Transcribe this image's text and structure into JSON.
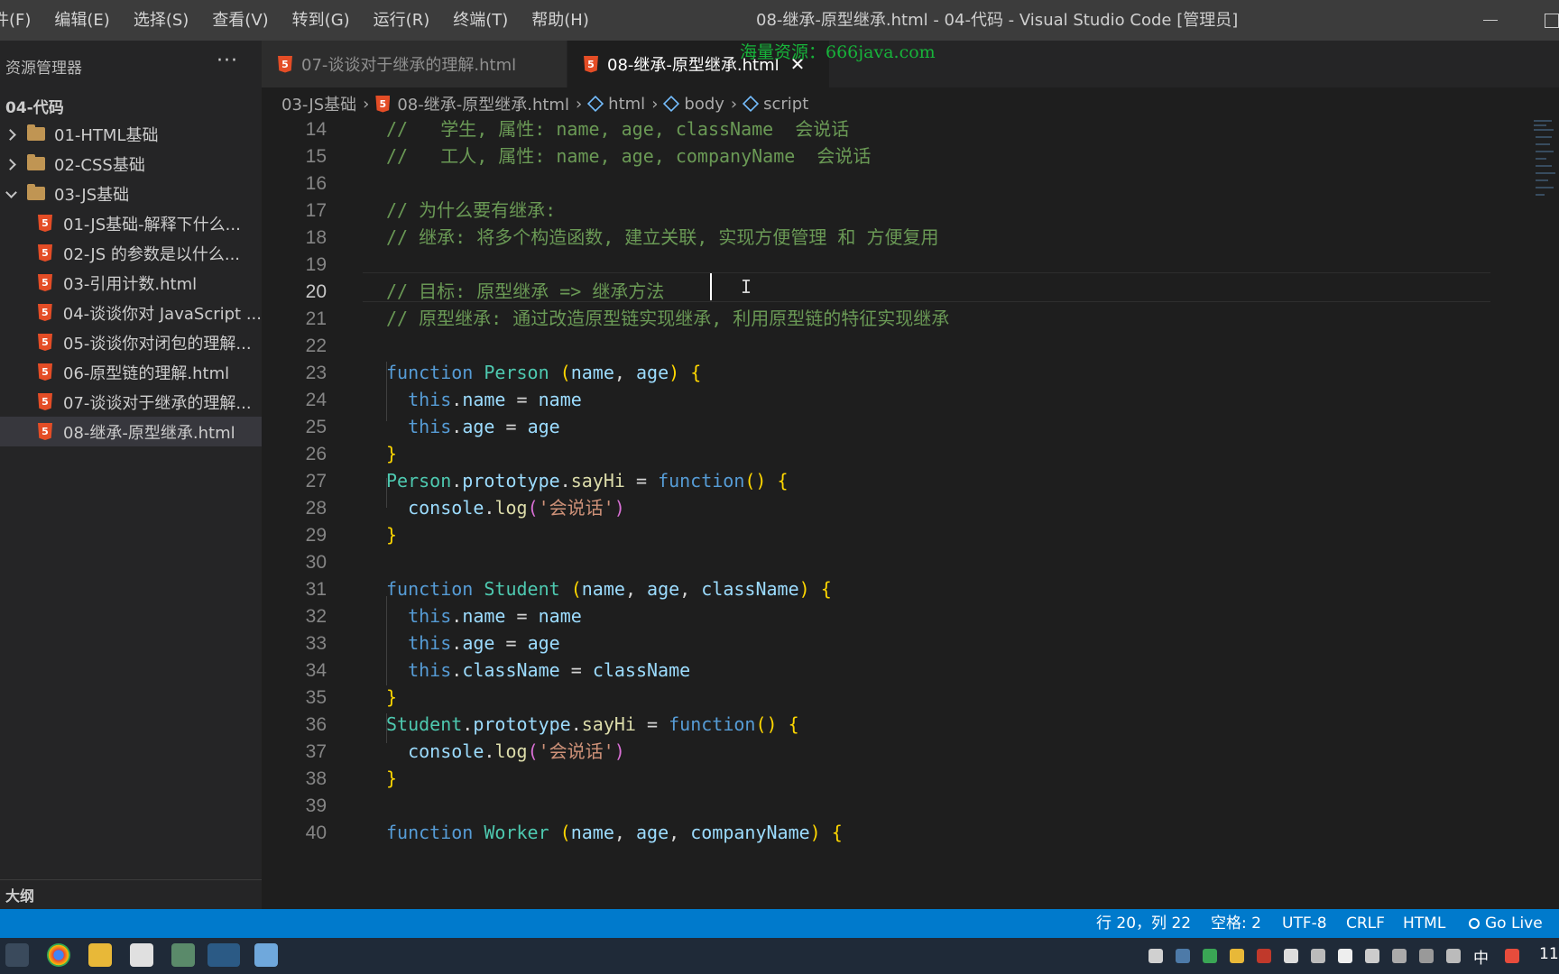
{
  "menu": [
    "件(F)",
    "编辑(E)",
    "选择(S)",
    "查看(V)",
    "转到(G)",
    "运行(R)",
    "终端(T)",
    "帮助(H)"
  ],
  "window_title": "08-继承-原型继承.html - 04-代码 - Visual Studio Code [管理员]",
  "watermark": "海量资源：666java.com",
  "sidebar": {
    "title": "资源管理器",
    "more": "···",
    "root": "04-代码",
    "folders": [
      "01-HTML基础",
      "02-CSS基础",
      "03-JS基础"
    ],
    "files": [
      "01-JS基础-解释下什么...",
      "02-JS 的参数是以什么...",
      "03-引用计数.html",
      "04-谈谈你对 JavaScript ...",
      "05-谈谈你对闭包的理解...",
      "06-原型链的理解.html",
      "07-谈谈对于继承的理解...",
      "08-继承-原型继承.html"
    ],
    "outline": "大纲"
  },
  "tabs": [
    {
      "label": "07-谈谈对于继承的理解.html",
      "icon": "html5-icon"
    },
    {
      "label": "08-继承-原型继承.html",
      "icon": "html5-icon",
      "close": "✕"
    }
  ],
  "breadcrumb": [
    "03-JS基础",
    "08-继承-原型继承.html",
    "html",
    "body",
    "script"
  ],
  "code_lines": [
    {
      "n": "14",
      "code": [
        [
          "c-com",
          "//   学生, 属性: name, age, className  会说话"
        ]
      ]
    },
    {
      "n": "15",
      "code": [
        [
          "c-com",
          "//   工人, 属性: name, age, companyName  会说话"
        ]
      ]
    },
    {
      "n": "16",
      "code": []
    },
    {
      "n": "17",
      "code": [
        [
          "c-com",
          "// 为什么要有继承:"
        ]
      ]
    },
    {
      "n": "18",
      "code": [
        [
          "c-com",
          "// 继承: 将多个构造函数, 建立关联, 实现方便管理 和 方便复用"
        ]
      ]
    },
    {
      "n": "19",
      "code": []
    },
    {
      "n": "20",
      "code": [
        [
          "c-com",
          "// 目标: 原型继承 => 继承方法"
        ]
      ]
    },
    {
      "n": "21",
      "code": [
        [
          "c-com",
          "// 原型继承: 通过改造原型链实现继承, 利用原型链的特征实现继承"
        ]
      ]
    },
    {
      "n": "22",
      "code": []
    },
    {
      "n": "23",
      "code": [
        [
          "c-kw",
          "function "
        ],
        [
          "c-cls",
          "Person"
        ],
        [
          "c-op",
          " "
        ],
        [
          "c-br1",
          "("
        ],
        [
          "c-var",
          "name"
        ],
        [
          "c-op",
          ", "
        ],
        [
          "c-var",
          "age"
        ],
        [
          "c-br1",
          ")"
        ],
        [
          "c-op",
          " "
        ],
        [
          "c-br1",
          "{"
        ]
      ]
    },
    {
      "n": "24",
      "code": [
        [
          "c-op",
          "  "
        ],
        [
          "c-kw",
          "this"
        ],
        [
          "c-op",
          "."
        ],
        [
          "c-var",
          "name"
        ],
        [
          "c-op",
          " = "
        ],
        [
          "c-var",
          "name"
        ]
      ]
    },
    {
      "n": "25",
      "code": [
        [
          "c-op",
          "  "
        ],
        [
          "c-kw",
          "this"
        ],
        [
          "c-op",
          "."
        ],
        [
          "c-var",
          "age"
        ],
        [
          "c-op",
          " = "
        ],
        [
          "c-var",
          "age"
        ]
      ]
    },
    {
      "n": "26",
      "code": [
        [
          "c-br1",
          "}"
        ]
      ]
    },
    {
      "n": "27",
      "code": [
        [
          "c-cls",
          "Person"
        ],
        [
          "c-op",
          "."
        ],
        [
          "c-var",
          "prototype"
        ],
        [
          "c-op",
          "."
        ],
        [
          "c-fn",
          "sayHi"
        ],
        [
          "c-op",
          " = "
        ],
        [
          "c-kw",
          "function"
        ],
        [
          "c-br1",
          "()"
        ],
        [
          "c-op",
          " "
        ],
        [
          "c-br1",
          "{"
        ]
      ]
    },
    {
      "n": "28",
      "code": [
        [
          "c-op",
          "  "
        ],
        [
          "c-var",
          "console"
        ],
        [
          "c-op",
          "."
        ],
        [
          "c-fn",
          "log"
        ],
        [
          "c-br2",
          "("
        ],
        [
          "c-str",
          "'会说话'"
        ],
        [
          "c-br2",
          ")"
        ]
      ]
    },
    {
      "n": "29",
      "code": [
        [
          "c-br1",
          "}"
        ]
      ]
    },
    {
      "n": "30",
      "code": []
    },
    {
      "n": "31",
      "code": [
        [
          "c-kw",
          "function "
        ],
        [
          "c-cls",
          "Student"
        ],
        [
          "c-op",
          " "
        ],
        [
          "c-br1",
          "("
        ],
        [
          "c-var",
          "name"
        ],
        [
          "c-op",
          ", "
        ],
        [
          "c-var",
          "age"
        ],
        [
          "c-op",
          ", "
        ],
        [
          "c-var",
          "className"
        ],
        [
          "c-br1",
          ")"
        ],
        [
          "c-op",
          " "
        ],
        [
          "c-br1",
          "{"
        ]
      ]
    },
    {
      "n": "32",
      "code": [
        [
          "c-op",
          "  "
        ],
        [
          "c-kw",
          "this"
        ],
        [
          "c-op",
          "."
        ],
        [
          "c-var",
          "name"
        ],
        [
          "c-op",
          " = "
        ],
        [
          "c-var",
          "name"
        ]
      ]
    },
    {
      "n": "33",
      "code": [
        [
          "c-op",
          "  "
        ],
        [
          "c-kw",
          "this"
        ],
        [
          "c-op",
          "."
        ],
        [
          "c-var",
          "age"
        ],
        [
          "c-op",
          " = "
        ],
        [
          "c-var",
          "age"
        ]
      ]
    },
    {
      "n": "34",
      "code": [
        [
          "c-op",
          "  "
        ],
        [
          "c-kw",
          "this"
        ],
        [
          "c-op",
          "."
        ],
        [
          "c-var",
          "className"
        ],
        [
          "c-op",
          " = "
        ],
        [
          "c-var",
          "className"
        ]
      ]
    },
    {
      "n": "35",
      "code": [
        [
          "c-br1",
          "}"
        ]
      ]
    },
    {
      "n": "36",
      "code": [
        [
          "c-cls",
          "Student"
        ],
        [
          "c-op",
          "."
        ],
        [
          "c-var",
          "prototype"
        ],
        [
          "c-op",
          "."
        ],
        [
          "c-fn",
          "sayHi"
        ],
        [
          "c-op",
          " = "
        ],
        [
          "c-kw",
          "function"
        ],
        [
          "c-br1",
          "()"
        ],
        [
          "c-op",
          " "
        ],
        [
          "c-br1",
          "{"
        ]
      ]
    },
    {
      "n": "37",
      "code": [
        [
          "c-op",
          "  "
        ],
        [
          "c-var",
          "console"
        ],
        [
          "c-op",
          "."
        ],
        [
          "c-fn",
          "log"
        ],
        [
          "c-br2",
          "("
        ],
        [
          "c-str",
          "'会说话'"
        ],
        [
          "c-br2",
          ")"
        ]
      ]
    },
    {
      "n": "38",
      "code": [
        [
          "c-br1",
          "}"
        ]
      ]
    },
    {
      "n": "39",
      "code": []
    },
    {
      "n": "40",
      "code": [
        [
          "c-kw",
          "function "
        ],
        [
          "c-cls",
          "Worker"
        ],
        [
          "c-op",
          " "
        ],
        [
          "c-br1",
          "("
        ],
        [
          "c-var",
          "name"
        ],
        [
          "c-op",
          ", "
        ],
        [
          "c-var",
          "age"
        ],
        [
          "c-op",
          ", "
        ],
        [
          "c-var",
          "companyName"
        ],
        [
          "c-br1",
          ")"
        ],
        [
          "c-op",
          " "
        ],
        [
          "c-br1",
          "{"
        ]
      ]
    }
  ],
  "status": {
    "position": "行 20，列 22",
    "spaces": "空格: 2",
    "encoding": "UTF-8",
    "eol": "CRLF",
    "language": "HTML",
    "golive": "Go Live"
  },
  "taskbar": {
    "ime": "中",
    "clock": "11"
  },
  "colors": {
    "statusbar": "#007acc",
    "comment": "#6a9955",
    "keyword": "#569cd6",
    "watermark": "#17b33a"
  }
}
